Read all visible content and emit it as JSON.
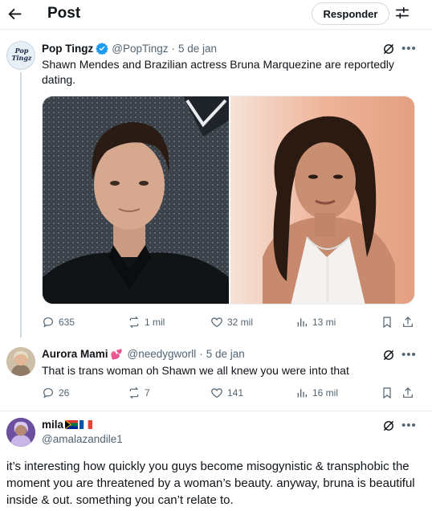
{
  "header": {
    "title": "Post",
    "reply_label": "Responder"
  },
  "tweets": [
    {
      "name": "Pop Tingz",
      "verified": true,
      "handle": "@PopTingz",
      "date": "5 de jan",
      "text": "Shawn Mendes and Brazilian actress Bruna Marquezine are reportedly dating.",
      "avatar_text": "Pop Tingz",
      "stats": {
        "replies": "635",
        "reposts": "1 mil",
        "likes": "32 mil",
        "views": "13 mi"
      }
    },
    {
      "name": "Aurora Mami",
      "name_emoji": "💕",
      "handle": "@needygworll",
      "date": "5 de jan",
      "text": "That is trans woman oh Shawn we all knew you were into that",
      "stats": {
        "replies": "26",
        "reposts": "7",
        "likes": "141",
        "views": "16 mil"
      }
    },
    {
      "name": "mila",
      "handle": "@amalazandile1",
      "text": "it’s interesting how quickly you guys become misogynistic & transphobic the moment you are threatened by a woman’s beauty. anyway, bruna is beautiful inside & out. something you can’t relate to."
    }
  ],
  "colors": {
    "text": "#0f1419",
    "secondary": "#536471",
    "verified": "#1d9bf0",
    "border": "#cfd9de"
  }
}
